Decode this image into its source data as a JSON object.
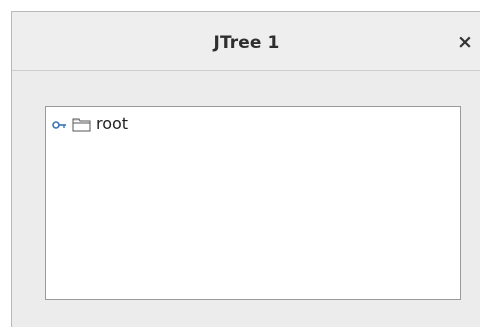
{
  "window": {
    "title": "JTree 1",
    "close_glyph": "×"
  },
  "tree": {
    "nodes": [
      {
        "label": "root",
        "icon": "folder-icon",
        "expanded": false
      }
    ]
  },
  "colors": {
    "handle_blue": "#3b73b9",
    "folder_outline": "#555555"
  }
}
